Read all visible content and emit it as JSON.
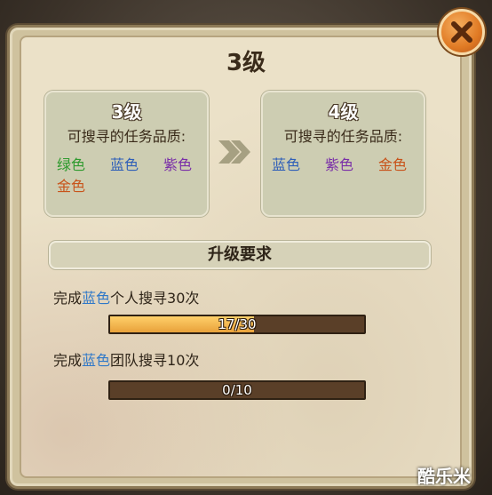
{
  "title": "3级",
  "current": {
    "level": "3级",
    "label": "可搜寻的任务品质:",
    "qualities": [
      {
        "name": "绿色",
        "color": "#2e9a2e"
      },
      {
        "name": "蓝色",
        "color": "#2f5fb8"
      },
      {
        "name": "紫色",
        "color": "#7a2fa8"
      },
      {
        "name": "金色",
        "color": "#c8531a"
      }
    ]
  },
  "next": {
    "level": "4级",
    "label": "可搜寻的任务品质:",
    "qualities": [
      {
        "name": "蓝色",
        "color": "#2f5fb8"
      },
      {
        "name": "紫色",
        "color": "#7a2fa8"
      },
      {
        "name": "金色",
        "color": "#c8531a"
      }
    ]
  },
  "requirements": {
    "header": "升级要求",
    "items": [
      {
        "prefix": "完成",
        "highlight": "蓝色",
        "suffix": "个人搜寻30次",
        "progress_text": "17/30",
        "progress": 0.567
      },
      {
        "prefix": "完成",
        "highlight": "蓝色",
        "suffix": "团队搜寻10次",
        "progress_text": "0/10",
        "progress": 0
      }
    ]
  },
  "watermark": "酷乐米",
  "icons": {
    "close": "close-icon",
    "arrow": "double-chevron-right-icon"
  }
}
